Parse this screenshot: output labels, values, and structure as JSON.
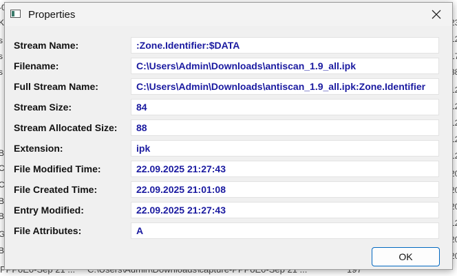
{
  "dialog": {
    "title": "Properties",
    "close_icon": "close-icon",
    "ok_label": "OK"
  },
  "fields": [
    {
      "label": "Stream Name:",
      "value": ":Zone.Identifier:$DATA"
    },
    {
      "label": "Filename:",
      "value": "C:\\Users\\Admin\\Downloads\\antiscan_1.9_all.ipk"
    },
    {
      "label": "Full Stream Name:",
      "value": "C:\\Users\\Admin\\Downloads\\antiscan_1.9_all.ipk:Zone.Identifier"
    },
    {
      "label": "Stream Size:",
      "value": "84"
    },
    {
      "label": "Stream Allocated Size:",
      "value": "88"
    },
    {
      "label": "Extension:",
      "value": "ipk"
    },
    {
      "label": "File Modified Time:",
      "value": "22.09.2025 21:27:43"
    },
    {
      "label": "File Created Time:",
      "value": "22.09.2025 21:01:08"
    },
    {
      "label": "Entry Modified:",
      "value": "22.09.2025 21:27:43"
    },
    {
      "label": "File Attributes:",
      "value": "A"
    }
  ],
  "background": {
    "left_chars": [
      "-0",
      "K",
      "s",
      "s",
      "s",
      "B",
      "C",
      "C",
      "B",
      "B",
      "B",
      "B",
      "B",
      "B",
      "G",
      "B"
    ],
    "right_chars": [
      "23",
      "12",
      "17",
      "38",
      "12",
      "12",
      "12",
      "12",
      "12",
      "20",
      "20",
      "20",
      "12",
      "20",
      "20"
    ],
    "bottom_name": "PPPoE0-Sep 21 ...",
    "bottom_path": "C:\\Users\\Admin\\Downloads\\capture-PPPoE0-Sep 21 ...",
    "bottom_size": "197"
  },
  "colors": {
    "value_text": "#1a1aa0",
    "ok_border": "#0067c0"
  }
}
